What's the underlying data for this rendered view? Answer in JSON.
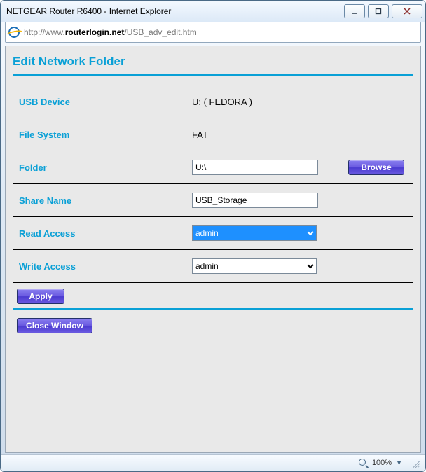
{
  "window": {
    "title": "NETGEAR Router R6400 - Internet Explorer",
    "url_prefix": "http://www.",
    "url_bold": "routerlogin.net",
    "url_suffix": "/USB_adv_edit.htm"
  },
  "page": {
    "title": "Edit Network Folder"
  },
  "labels": {
    "usb_device": "USB Device",
    "file_system": "File System",
    "folder": "Folder",
    "share_name": "Share Name",
    "read_access": "Read Access",
    "write_access": "Write Access"
  },
  "values": {
    "usb_device": "U: ( FEDORA )",
    "file_system": "FAT",
    "folder": "U:\\",
    "share_name": "USB_Storage",
    "read_access": "admin",
    "write_access": "admin"
  },
  "buttons": {
    "browse": "Browse",
    "apply": "Apply",
    "close_window": "Close Window"
  },
  "status": {
    "zoom": "100%"
  }
}
